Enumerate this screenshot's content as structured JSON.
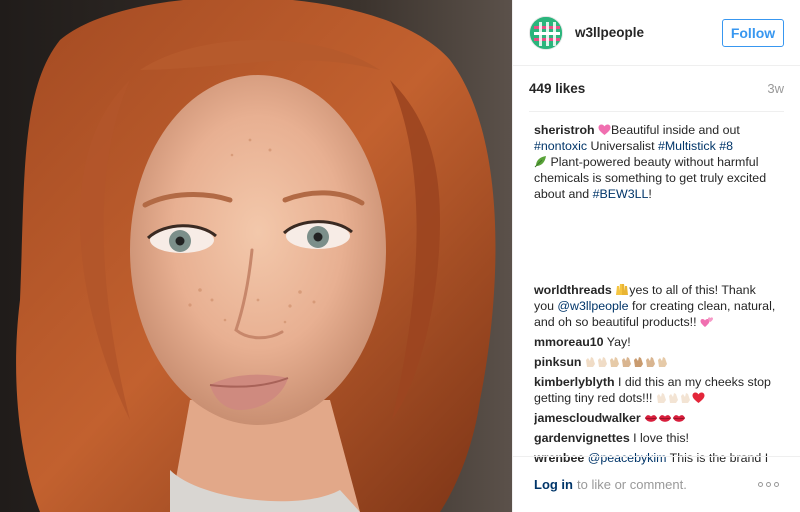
{
  "post": {
    "username": "w3llpeople",
    "follow_label": "Follow",
    "likes": "449 likes",
    "age": "3w"
  },
  "caption": {
    "user": "sheristroh",
    "line1_text": "Beautiful inside and out",
    "tag1": "#nontoxic",
    "word1": " Universalist ",
    "tag2": "#Multistick",
    "tag3": "#8",
    "line2_text": "Plant-powered beauty without harmful chemicals is something to get truly excited about and ",
    "tag4": "#BEW3LL",
    "line2_end": "!"
  },
  "comments": [
    {
      "user": "worldthreads",
      "pre": "yes to all of this! Thank you ",
      "mention": "@w3llpeople",
      "post": " for creating clean, natural, and oh so beautiful products!! "
    },
    {
      "user": "mmoreau10",
      "text": "Yay!"
    },
    {
      "user": "pinksun",
      "text": ""
    },
    {
      "user": "kimberlyblyth",
      "text": "I did this an my cheeks stop getting tiny red dots!!! "
    },
    {
      "user": "jamescloudwalker",
      "text": ""
    },
    {
      "user": "gardenvignettes",
      "text": "I love this!"
    },
    {
      "user": "wrenbee",
      "mention": "@peacebykim",
      "text": " This is the brand I"
    }
  ],
  "footer": {
    "login_label": "Log in",
    "text": "to like or comment."
  },
  "icons": {
    "more": "more-options-icon",
    "avatar": "brand-avatar"
  },
  "colors": {
    "link_blue": "#3897f0",
    "tag_blue": "#003569",
    "muted": "#999999"
  }
}
